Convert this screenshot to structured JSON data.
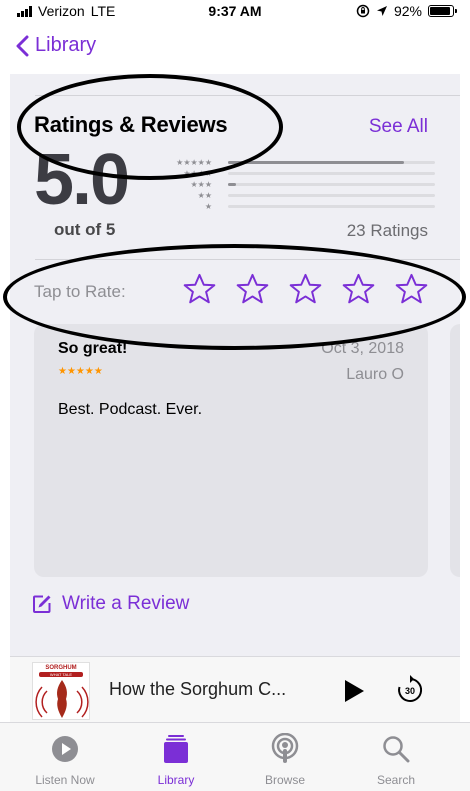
{
  "status_bar": {
    "carrier": "Verizon",
    "network": "LTE",
    "time": "9:37 AM",
    "battery_percent": "92%",
    "battery_level": 0.92
  },
  "nav": {
    "back_label": "Library"
  },
  "ratings": {
    "title": "Ratings & Reviews",
    "see_all_label": "See All",
    "score": "5.0",
    "out_of": "out of 5",
    "count_label": "23 Ratings",
    "distribution": [
      {
        "stars": "★★★★★",
        "fraction": 0.85
      },
      {
        "stars": "★★★★",
        "fraction": 0.0
      },
      {
        "stars": "★★★",
        "fraction": 0.04
      },
      {
        "stars": "★★",
        "fraction": 0.0
      },
      {
        "stars": "★",
        "fraction": 0.0
      }
    ]
  },
  "tap_to_rate": {
    "label": "Tap to Rate:",
    "stars": 5
  },
  "review": {
    "title": "So great!",
    "date": "Oct 3, 2018",
    "stars": "★★★★★",
    "author": "Lauro O",
    "body": "Best. Podcast. Ever."
  },
  "write_review_label": "Write a Review",
  "player": {
    "artwork_title": "SORGHUM",
    "artwork_subtitle": "WHAT TALE",
    "title": "How the Sorghum C...",
    "skip_seconds": "30"
  },
  "tabs": [
    {
      "label": "Listen Now",
      "icon": "play-circle-icon"
    },
    {
      "label": "Library",
      "icon": "library-stack-icon"
    },
    {
      "label": "Browse",
      "icon": "podcast-icon"
    },
    {
      "label": "Search",
      "icon": "search-icon"
    }
  ],
  "colors": {
    "accent": "#7b2fd6",
    "review_stars": "#ff9500",
    "annotation": "#000000"
  }
}
